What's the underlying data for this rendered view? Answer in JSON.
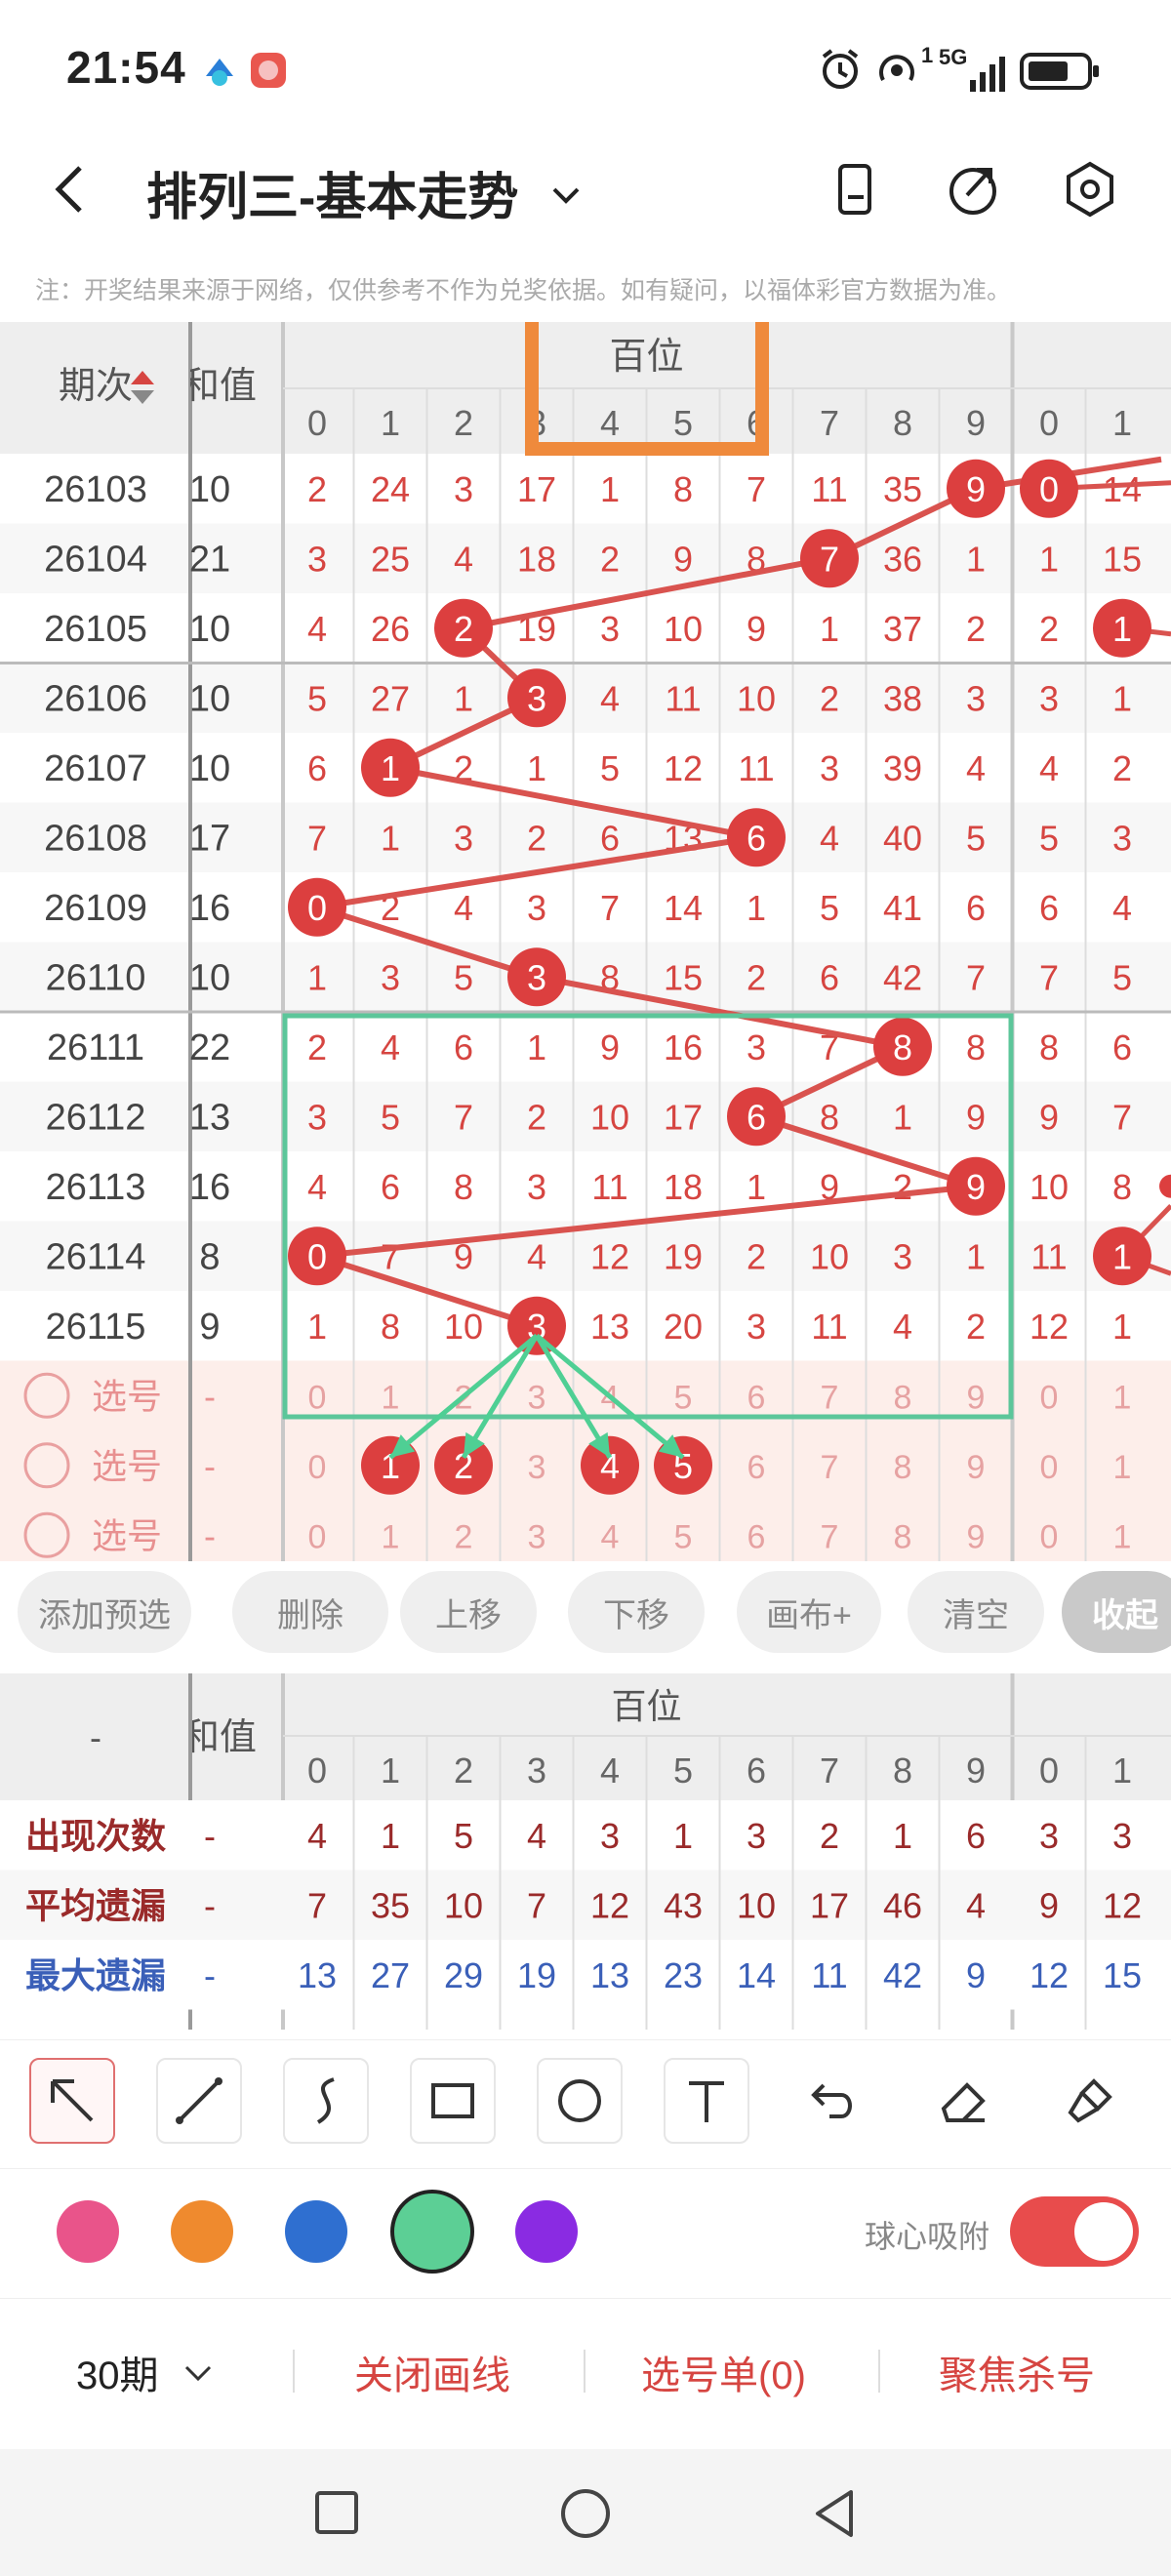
{
  "status": {
    "time": "21:54",
    "network": "5G",
    "network_sup": "1"
  },
  "header": {
    "title": "排列三-基本走势"
  },
  "note": "注：开奖结果来源于网络，仅供参考不作为兑奖依据。如有疑问，以福体彩官方数据为准。",
  "table": {
    "period_header": "期次",
    "sum_header": "和值",
    "group_header": "百位",
    "digit_headers": [
      "0",
      "1",
      "2",
      "3",
      "4",
      "5",
      "6",
      "7",
      "8",
      "9"
    ],
    "extra_headers": [
      "0",
      "1"
    ],
    "rows": [
      {
        "period": "26103",
        "sum": "10",
        "cells": [
          "2",
          "24",
          "3",
          "17",
          "1",
          "8",
          "7",
          "11",
          "35",
          "9"
        ],
        "hit": 9,
        "extra": [
          "0",
          "14"
        ],
        "extra_hit": 0
      },
      {
        "period": "26104",
        "sum": "21",
        "cells": [
          "3",
          "25",
          "4",
          "18",
          "2",
          "9",
          "8",
          "7",
          "36",
          "1"
        ],
        "hit": 7,
        "extra": [
          "1",
          "15"
        ],
        "extra_hit": -1
      },
      {
        "period": "26105",
        "sum": "10",
        "cells": [
          "4",
          "26",
          "2",
          "19",
          "3",
          "10",
          "9",
          "1",
          "37",
          "2"
        ],
        "hit": 2,
        "extra": [
          "2",
          "1"
        ],
        "extra_hit": 1
      },
      {
        "period": "26106",
        "sum": "10",
        "cells": [
          "5",
          "27",
          "1",
          "3",
          "4",
          "11",
          "10",
          "2",
          "38",
          "3"
        ],
        "hit": 3,
        "extra": [
          "3",
          "1"
        ],
        "extra_hit": -1
      },
      {
        "period": "26107",
        "sum": "10",
        "cells": [
          "6",
          "1",
          "2",
          "1",
          "5",
          "12",
          "11",
          "3",
          "39",
          "4"
        ],
        "hit": 1,
        "extra": [
          "4",
          "2"
        ],
        "extra_hit": -1
      },
      {
        "period": "26108",
        "sum": "17",
        "cells": [
          "7",
          "1",
          "3",
          "2",
          "6",
          "13",
          "6",
          "4",
          "40",
          "5"
        ],
        "hit": 6,
        "extra": [
          "5",
          "3"
        ],
        "extra_hit": -1
      },
      {
        "period": "26109",
        "sum": "16",
        "cells": [
          "0",
          "2",
          "4",
          "3",
          "7",
          "14",
          "1",
          "5",
          "41",
          "6"
        ],
        "hit": 0,
        "extra": [
          "6",
          "4"
        ],
        "extra_hit": -1
      },
      {
        "period": "26110",
        "sum": "10",
        "cells": [
          "1",
          "3",
          "5",
          "3",
          "8",
          "15",
          "2",
          "6",
          "42",
          "7"
        ],
        "hit": 3,
        "extra": [
          "7",
          "5"
        ],
        "extra_hit": -1
      },
      {
        "period": "26111",
        "sum": "22",
        "cells": [
          "2",
          "4",
          "6",
          "1",
          "9",
          "16",
          "3",
          "7",
          "8",
          "8"
        ],
        "hit": 8,
        "extra": [
          "8",
          "6"
        ],
        "extra_hit": -1
      },
      {
        "period": "26112",
        "sum": "13",
        "cells": [
          "3",
          "5",
          "7",
          "2",
          "10",
          "17",
          "6",
          "8",
          "1",
          "9"
        ],
        "hit": 6,
        "extra": [
          "9",
          "7"
        ],
        "extra_hit": -1
      },
      {
        "period": "26113",
        "sum": "16",
        "cells": [
          "4",
          "6",
          "8",
          "3",
          "11",
          "18",
          "1",
          "9",
          "2",
          "9"
        ],
        "hit": 9,
        "extra": [
          "10",
          "8"
        ],
        "extra_hit": -1
      },
      {
        "period": "26114",
        "sum": "8",
        "cells": [
          "0",
          "7",
          "9",
          "4",
          "12",
          "19",
          "2",
          "10",
          "3",
          "1"
        ],
        "hit": 0,
        "extra": [
          "11",
          "1"
        ],
        "extra_hit": 1
      },
      {
        "period": "26115",
        "sum": "9",
        "cells": [
          "1",
          "8",
          "10",
          "3",
          "13",
          "20",
          "3",
          "11",
          "4",
          "2"
        ],
        "hit": 3,
        "extra": [
          "12",
          "1"
        ],
        "extra_hit": -1
      }
    ],
    "pick_rows": [
      {
        "label": "选号",
        "sum": "-",
        "cells": [
          "0",
          "1",
          "2",
          "3",
          "4",
          "5",
          "6",
          "7",
          "8",
          "9"
        ],
        "picked": [],
        "extra": [
          "0",
          "1"
        ]
      },
      {
        "label": "选号",
        "sum": "-",
        "cells": [
          "0",
          "1",
          "2",
          "3",
          "4",
          "5",
          "6",
          "7",
          "8",
          "9"
        ],
        "picked": [
          1,
          2,
          4,
          5
        ],
        "extra": [
          "0",
          "1"
        ]
      },
      {
        "label": "选号",
        "sum": "-",
        "cells": [
          "0",
          "1",
          "2",
          "3",
          "4",
          "5",
          "6",
          "7",
          "8",
          "9"
        ],
        "picked": [],
        "extra": [
          "0",
          "1"
        ]
      }
    ]
  },
  "actions": [
    "添加预选",
    "删除",
    "上移",
    "下移",
    "画布+",
    "清空",
    "收起"
  ],
  "stats": {
    "corner": "-",
    "sum_header": "和值",
    "group_header": "百位",
    "digit_headers": [
      "0",
      "1",
      "2",
      "3",
      "4",
      "5",
      "6",
      "7",
      "8",
      "9"
    ],
    "extra_headers": [
      "0",
      "1"
    ],
    "rows": [
      {
        "label": "出现次数",
        "dash": "-",
        "cells": [
          "4",
          "1",
          "5",
          "4",
          "3",
          "1",
          "3",
          "2",
          "1",
          "6"
        ],
        "extra": [
          "3",
          "3"
        ],
        "color": "#9a2a2a"
      },
      {
        "label": "平均遗漏",
        "dash": "-",
        "cells": [
          "7",
          "35",
          "10",
          "7",
          "12",
          "43",
          "10",
          "17",
          "46",
          "4"
        ],
        "extra": [
          "9",
          "12"
        ],
        "color": "#9a2a2a"
      },
      {
        "label": "最大遗漏",
        "dash": "-",
        "cells": [
          "13",
          "27",
          "29",
          "19",
          "13",
          "23",
          "14",
          "11",
          "42",
          "9"
        ],
        "extra": [
          "12",
          "15"
        ],
        "color": "#3a5fb8"
      }
    ]
  },
  "tools": [
    "select-arrow",
    "line",
    "curve",
    "rectangle",
    "circle",
    "text",
    "undo",
    "eraser",
    "brush"
  ],
  "colors": {
    "swatches": [
      "#e9548a",
      "#ef8a2e",
      "#2f6fd0",
      "#5ccf95",
      "#8a2be2"
    ],
    "selected_index": 3,
    "accent": "#d64541",
    "snap_label": "球心吸附",
    "snap_on": true
  },
  "bottombar": {
    "periods": "30期",
    "close_lines": "关闭画线",
    "ticket": "选号单(0)",
    "focus_kill": "聚焦杀号"
  }
}
